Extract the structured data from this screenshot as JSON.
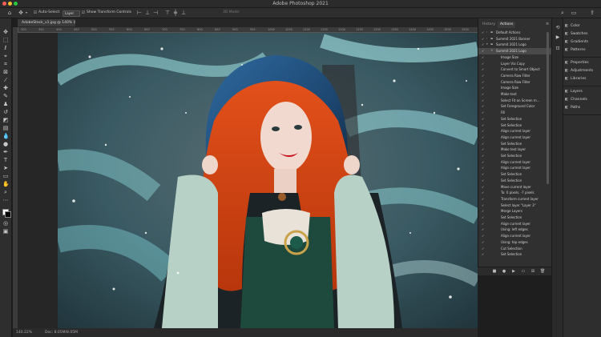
{
  "app": {
    "window_title": "Adobe Photoshop 2021",
    "colors": {
      "close": "#ff5f57",
      "minimize": "#febc2e",
      "zoom": "#28c840",
      "panel_bg": "#303030",
      "app_bg": "#1e1e1e"
    }
  },
  "options_bar": {
    "home_icon": "home-icon",
    "move_icon": "move-tool-icon",
    "auto_select_label": "Auto-Select:",
    "auto_select_value": "Layer",
    "transform_label": "Show Transform Controls",
    "align_icons": [
      "align-left-icon",
      "align-center-icon",
      "align-right-icon",
      "align-top-icon",
      "align-middle-icon",
      "align-bottom-icon"
    ],
    "mode_label": "3D Mode:",
    "right_icons": [
      "search-icon",
      "workspace-icon",
      "share-icon"
    ]
  },
  "document": {
    "tab_label": "AdobeStock_v1.jpg @ 140% (RGB/8#) *",
    "zoom": "140.22%",
    "doc_info": "Doc: 8.05M/8.05M"
  },
  "ruler_ticks": [
    "300",
    "350",
    "400",
    "450",
    "500",
    "550",
    "600",
    "650",
    "700",
    "750",
    "800",
    "850",
    "900",
    "950",
    "1000",
    "1050",
    "1100",
    "1150",
    "1200",
    "1250",
    "1300",
    "1350",
    "1400",
    "1450",
    "1500",
    "1550"
  ],
  "toolbar": {
    "tools": [
      "move-tool",
      "marquee-tool",
      "lasso-tool",
      "object-select-tool",
      "crop-tool",
      "frame-tool",
      "eyedropper-tool",
      "spot-healing-tool",
      "brush-tool",
      "clone-stamp-tool",
      "history-brush-tool",
      "eraser-tool",
      "gradient-tool",
      "blur-tool",
      "dodge-tool",
      "pen-tool",
      "type-tool",
      "path-select-tool",
      "rectangle-tool",
      "hand-tool",
      "zoom-tool",
      "more-tools",
      "color-swatches",
      "quick-mask",
      "screen-mode"
    ]
  },
  "actions_panel": {
    "tab_history": "History",
    "tab_actions": "Actions",
    "rows": [
      {
        "label": "Default Actions",
        "level": 0,
        "checked": true,
        "expanded": false
      },
      {
        "label": "Summit 2021 Banner",
        "level": 0,
        "checked": true,
        "expanded": false
      },
      {
        "label": "Summit 2021 Logo",
        "level": 0,
        "checked": true,
        "expanded": true
      },
      {
        "label": "Summit 2021 Logo",
        "level": 1,
        "checked": true,
        "expanded": true,
        "selected": true
      },
      {
        "label": "Image Size",
        "level": 2,
        "checked": true
      },
      {
        "label": "Layer Via Copy",
        "level": 2,
        "checked": true
      },
      {
        "label": "Convert to Smart Object",
        "level": 2,
        "checked": true
      },
      {
        "label": "Camera Raw Filter",
        "level": 2,
        "checked": true
      },
      {
        "label": "Camera Raw Filter",
        "level": 2,
        "checked": true
      },
      {
        "label": "Image Size",
        "level": 2,
        "checked": true
      },
      {
        "label": "Make text",
        "level": 2,
        "checked": true
      },
      {
        "label": "Select Fit on Screen m...",
        "level": 2,
        "checked": true
      },
      {
        "label": "Set Foreground Color",
        "level": 2,
        "checked": true
      },
      {
        "label": "Fill",
        "level": 2,
        "checked": true
      },
      {
        "label": "Set Selection",
        "level": 2,
        "checked": true
      },
      {
        "label": "Set Selection",
        "level": 2,
        "checked": true
      },
      {
        "label": "Align current layer",
        "level": 2,
        "checked": true
      },
      {
        "label": "Align current layer",
        "level": 2,
        "checked": true
      },
      {
        "label": "Set Selection",
        "level": 2,
        "checked": true
      },
      {
        "label": "Make text layer",
        "level": 2,
        "checked": true
      },
      {
        "label": "Set Selection",
        "level": 2,
        "checked": true
      },
      {
        "label": "Align current layer",
        "level": 2,
        "checked": true
      },
      {
        "label": "Align current layer",
        "level": 2,
        "checked": true
      },
      {
        "label": "Set Selection",
        "level": 2,
        "checked": true
      },
      {
        "label": "Set Selection",
        "level": 2,
        "checked": true
      },
      {
        "label": "Move current layer",
        "level": 2,
        "checked": true
      },
      {
        "label": "To: 0 pixels, -7 pixels",
        "level": 2,
        "checked": true
      },
      {
        "label": "Transform current layer",
        "level": 2,
        "checked": true
      },
      {
        "label": "Select layer \"Layer 3\"",
        "level": 2,
        "checked": true
      },
      {
        "label": "Merge Layers",
        "level": 2,
        "checked": true
      },
      {
        "label": "Set Selection",
        "level": 2,
        "checked": true
      },
      {
        "label": "Align current layer",
        "level": 2,
        "checked": true
      },
      {
        "label": "Using: left edges",
        "level": 2,
        "checked": true
      },
      {
        "label": "Align current layer",
        "level": 2,
        "checked": true
      },
      {
        "label": "Using: top edges",
        "level": 2,
        "checked": true
      },
      {
        "label": "Cut Selection",
        "level": 2,
        "checked": true
      },
      {
        "label": "Set Selection",
        "level": 2,
        "checked": true
      }
    ],
    "footer_icons": [
      "stop-icon",
      "record-icon",
      "play-icon",
      "new-set-icon",
      "new-action-icon",
      "delete-icon"
    ]
  },
  "panels_list": {
    "groups": [
      [
        {
          "icon": "color-icon",
          "label": "Color"
        },
        {
          "icon": "swatches-icon",
          "label": "Swatches"
        },
        {
          "icon": "gradients-icon",
          "label": "Gradients"
        },
        {
          "icon": "patterns-icon",
          "label": "Patterns"
        }
      ],
      [
        {
          "icon": "properties-icon",
          "label": "Properties"
        },
        {
          "icon": "adjustments-icon",
          "label": "Adjustments"
        },
        {
          "icon": "libraries-icon",
          "label": "Libraries"
        }
      ],
      [
        {
          "icon": "layers-icon",
          "label": "Layers"
        },
        {
          "icon": "channels-icon",
          "label": "Channels"
        },
        {
          "icon": "paths-icon",
          "label": "Paths"
        }
      ]
    ]
  }
}
